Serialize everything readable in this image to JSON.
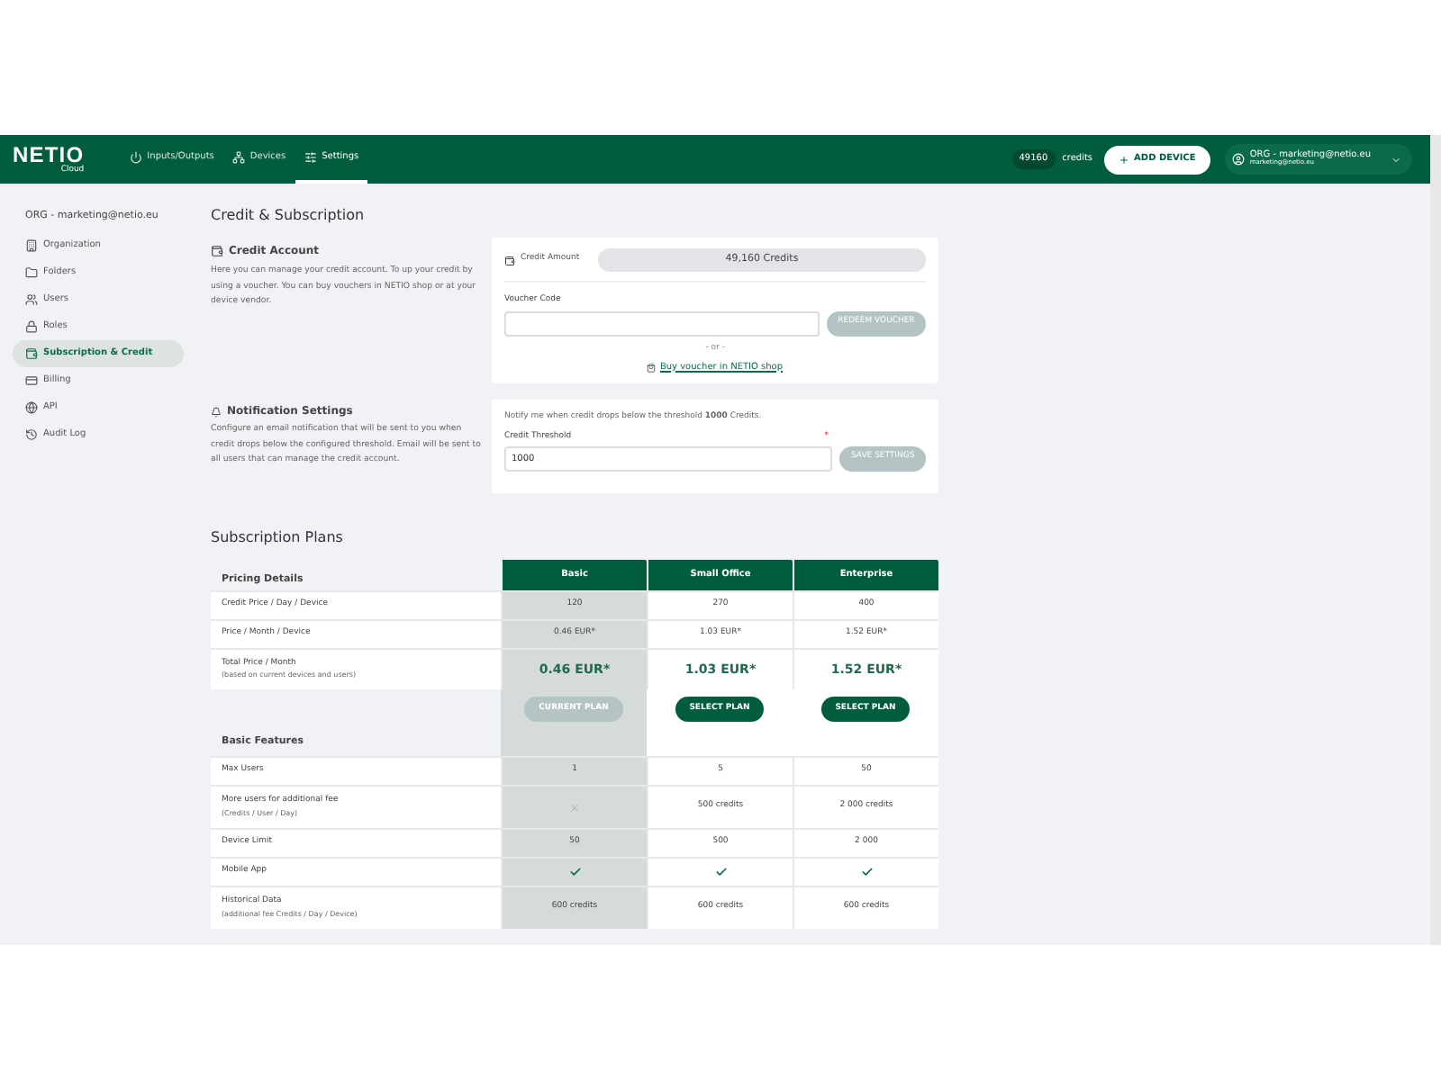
{
  "top_bar": {
    "logo": "NETIO",
    "logo_sub": "Cloud",
    "nav": [
      {
        "label": "Inputs/Outputs",
        "selected": false
      },
      {
        "label": "Devices",
        "selected": false
      },
      {
        "label": "Settings",
        "selected": true
      }
    ],
    "credits_value": "49160",
    "credits_label": "credits",
    "add_device": "ADD DEVICE",
    "account_name": "ORG - marketing@netio.eu",
    "account_email": "marketing@netio.eu"
  },
  "sidebar": {
    "org": "ORG - marketing@netio.eu",
    "items": [
      {
        "label": "Organization",
        "selected": false
      },
      {
        "label": "Folders",
        "selected": false
      },
      {
        "label": "Users",
        "selected": false
      },
      {
        "label": "Roles",
        "selected": false
      },
      {
        "label": "Subscription & Credit",
        "selected": true
      },
      {
        "label": "Billing",
        "selected": false
      },
      {
        "label": "API",
        "selected": false
      },
      {
        "label": "Audit Log",
        "selected": false
      }
    ]
  },
  "page_title": "Credit & Subscription",
  "credit_account": {
    "title": "Credit Account",
    "description": "Here you can manage your credit account. To up your credit by using a voucher. You can buy vouchers in NETIO shop or at your device vendor.",
    "amount_label": "Credit Amount",
    "amount_value": "49,160 Credits",
    "voucher_label": "Voucher Code",
    "redeem_button": "REDEEM VOUCHER",
    "redeem_disabled": true,
    "separator": "- or -",
    "shop_link": "Buy voucher in NETIO shop"
  },
  "notification": {
    "title": "Notification Settings",
    "description": "Configure an email notification that will be sent to you when credit drops below the configured threshold. Email will be sent to all users that can manage the credit account.",
    "notice": "Notify me when credit drops below the threshold **1000** Credits.",
    "threshold_label": "Credit Threshold",
    "required_mark": "*",
    "threshold_value": "1000",
    "save_button": "SAVE SETTINGS",
    "save_disabled": true
  },
  "subscription": {
    "title": "Subscription Plans",
    "pricing_title": "Pricing Details",
    "plans": [
      {
        "name": "Basic",
        "current": true,
        "button": "CURRENT PLAN"
      },
      {
        "name": "Small Office",
        "current": false,
        "button": "SELECT PLAN"
      },
      {
        "name": "Enterprise",
        "current": false,
        "button": "SELECT PLAN"
      }
    ],
    "pricing_rows": [
      {
        "label": "Credit Price / Day / Device",
        "kind": "plain",
        "cells": [
          "120",
          "270",
          "400"
        ]
      },
      {
        "label": "Price / Month / Device",
        "kind": "plain",
        "cells": [
          "0.46 EUR*",
          "1.03 EUR*",
          "1.52 EUR*"
        ]
      },
      {
        "label": "Total Price / Month",
        "sublabel": "(based on current devices and users)",
        "kind": "total",
        "cells": [
          "0.46 EUR*",
          "1.03 EUR*",
          "1.52 EUR*"
        ]
      }
    ],
    "features_title": "Basic Features",
    "feature_rows": [
      {
        "label": "Max Users",
        "cells": [
          {
            "kind": "text",
            "text": "1"
          },
          {
            "kind": "text",
            "text": "5"
          },
          {
            "kind": "text",
            "text": "50"
          }
        ]
      },
      {
        "label": "More users for additional fee",
        "sublabel": "(Credits / User / Day)",
        "cells": [
          {
            "kind": "cross"
          },
          {
            "kind": "text",
            "text": "500 credits"
          },
          {
            "kind": "text",
            "text": "2 000 credits"
          }
        ]
      },
      {
        "label": "Device Limit",
        "cells": [
          {
            "kind": "text",
            "text": "50"
          },
          {
            "kind": "text",
            "text": "500"
          },
          {
            "kind": "text",
            "text": "2 000"
          }
        ]
      },
      {
        "label": "Mobile App",
        "cells": [
          {
            "kind": "check"
          },
          {
            "kind": "check"
          },
          {
            "kind": "check"
          }
        ]
      },
      {
        "label": "Historical Data",
        "sublabel": "(additional fee Credits / Day / Device)",
        "cells": [
          {
            "kind": "text",
            "text": "600 credits"
          },
          {
            "kind": "text",
            "text": "600 credits"
          },
          {
            "kind": "text",
            "text": "600 credits"
          }
        ]
      }
    ]
  }
}
